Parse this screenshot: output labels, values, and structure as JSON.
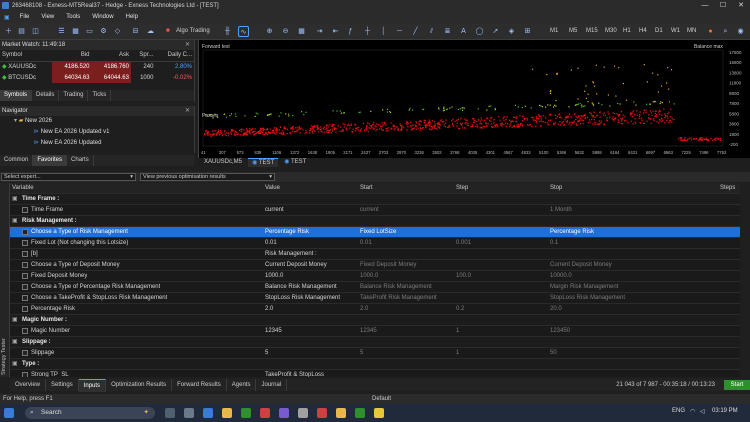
{
  "window": {
    "title": "263468108 - Exness-MT5Real37 - Hedge - Exness Technologies Ltd - [TEST]",
    "min": "—",
    "max": "☐",
    "close": "✕"
  },
  "menu": [
    "File",
    "View",
    "Tools",
    "Window",
    "Help"
  ],
  "toolbar": {
    "algo": "Algo Trading",
    "tf": [
      "M1",
      "M5",
      "M15",
      "M30",
      "H1",
      "H4",
      "D1",
      "W1",
      "MN"
    ]
  },
  "market_watch": {
    "title": "Market Watch: 11:49:18",
    "headers": [
      "Symbol",
      "Bid",
      "Ask",
      "Spr...",
      "Daily C..."
    ],
    "rows": [
      {
        "sym": "XAUUSDc",
        "bid": "4186.520",
        "ask": "4186.760",
        "spr": "240",
        "chg": "2.80%"
      },
      {
        "sym": "BTCUSDc",
        "bid": "64034.63",
        "ask": "64044.63",
        "spr": "1000",
        "chg": "-0.02%"
      }
    ],
    "tabs": [
      "Symbols",
      "Details",
      "Trading",
      "Ticks"
    ]
  },
  "navigator": {
    "title": "Navigator",
    "items": [
      "New 2026",
      "New EA 2026 Updated v1",
      "New EA 2026 Updated"
    ],
    "tabs": [
      "Common",
      "Favorites",
      "Charts"
    ]
  },
  "chart": {
    "label_left": "Forward test",
    "label_right": "Balance max",
    "pass_label": "Passes",
    "y_ticks": [
      "17800",
      "15800",
      "13800",
      "11800",
      "9800",
      "7800",
      "5800",
      "3800",
      "1800",
      "-200"
    ],
    "x_ticks": [
      "41",
      "307",
      "573",
      "839",
      "1106",
      "1372",
      "1638",
      "1905",
      "2171",
      "2437",
      "2703",
      "2970",
      "3236",
      "3502",
      "3768",
      "4035",
      "4301",
      "4567",
      "4833",
      "5100",
      "5366",
      "5632",
      "5898",
      "6164",
      "6431",
      "6697",
      "6963",
      "7229",
      "7496",
      "7762"
    ]
  },
  "chart_tabs": [
    "XAUUSDc,M5",
    "TEST",
    "TEST"
  ],
  "opt": {
    "expert": "Select expert...",
    "view": "View previous optimisation results"
  },
  "grid": {
    "headers": [
      "Variable",
      "Value",
      "Start",
      "Step",
      "Stop",
      "Steps"
    ],
    "rows": [
      {
        "type": "grp",
        "var": "Time Frame :"
      },
      {
        "type": "row",
        "chk": false,
        "var": "Time Frame",
        "val": "current",
        "start": "current",
        "step": "",
        "stop": "1 Month"
      },
      {
        "type": "grp",
        "var": "Risk Management :"
      },
      {
        "type": "sel",
        "chk": false,
        "var": "Choose a Type of Risk Management",
        "val": "Percentage Risk",
        "start": "Fixed LotSize",
        "step": "",
        "stop": "Percentage Risk"
      },
      {
        "type": "row",
        "chk": false,
        "var": "Fixed Lot (Not changing this Lotsize)",
        "val": "0.01",
        "start": "0.01",
        "step": "0.001",
        "stop": "0.1"
      },
      {
        "type": "row",
        "chk": false,
        "var": "[b]",
        "val": "Risk Management :",
        "start": "",
        "step": "",
        "stop": ""
      },
      {
        "type": "row",
        "chk": false,
        "var": "Choose a Type of Deposit Money",
        "val": "Current Deposit Money",
        "start": "Fixed Deposit Money",
        "step": "",
        "stop": "Current Deposit Money"
      },
      {
        "type": "row",
        "chk": false,
        "var": "Fixed Deposit Money",
        "val": "1000.0",
        "start": "1000.0",
        "step": "100.0",
        "stop": "10000.0"
      },
      {
        "type": "row",
        "chk": false,
        "var": "Choose a Type of Percentage Risk Management",
        "val": "Balance Risk Management",
        "start": "Balance Risk Management",
        "step": "",
        "stop": "Margin Risk Management"
      },
      {
        "type": "row",
        "chk": false,
        "var": "Choose a TakeProfit & StopLoss Risk Management",
        "val": "StopLoss Risk Management",
        "start": "TakeProfit Risk Management",
        "step": "",
        "stop": "StopLoss Risk Management"
      },
      {
        "type": "row",
        "chk": false,
        "var": "Percentage Risk",
        "val": "2.0",
        "start": "2.0",
        "step": "0.2",
        "stop": "20.0"
      },
      {
        "type": "grp",
        "var": "Magic Number :"
      },
      {
        "type": "row",
        "chk": false,
        "var": "Magic Number",
        "val": "12345",
        "start": "12345",
        "step": "1",
        "stop": "123450"
      },
      {
        "type": "grp",
        "var": "Slippage :"
      },
      {
        "type": "row",
        "chk": false,
        "var": "Slippage",
        "val": "5",
        "start": "5",
        "step": "1",
        "stop": "50"
      },
      {
        "type": "grp",
        "var": "Type :"
      },
      {
        "type": "row",
        "chk": false,
        "var": "Strong TP_SL",
        "val": "TakeProfit & StopLoss",
        "start": "",
        "step": "",
        "stop": ""
      }
    ]
  },
  "side_label": "Strategy Tester",
  "bottom_tabs": [
    "Overview",
    "Settings",
    "Inputs",
    "Optimization Results",
    "Forward Results",
    "Agents",
    "Journal"
  ],
  "progress": {
    "text": "21 043 of 7 987 - 00:35:18 / 00:13:23",
    "btn": "Start"
  },
  "status": {
    "help": "For Help, press F1",
    "profile": "Default"
  },
  "taskbar": {
    "search": "Search",
    "lang": "ENG",
    "time": "03:19 PM"
  }
}
